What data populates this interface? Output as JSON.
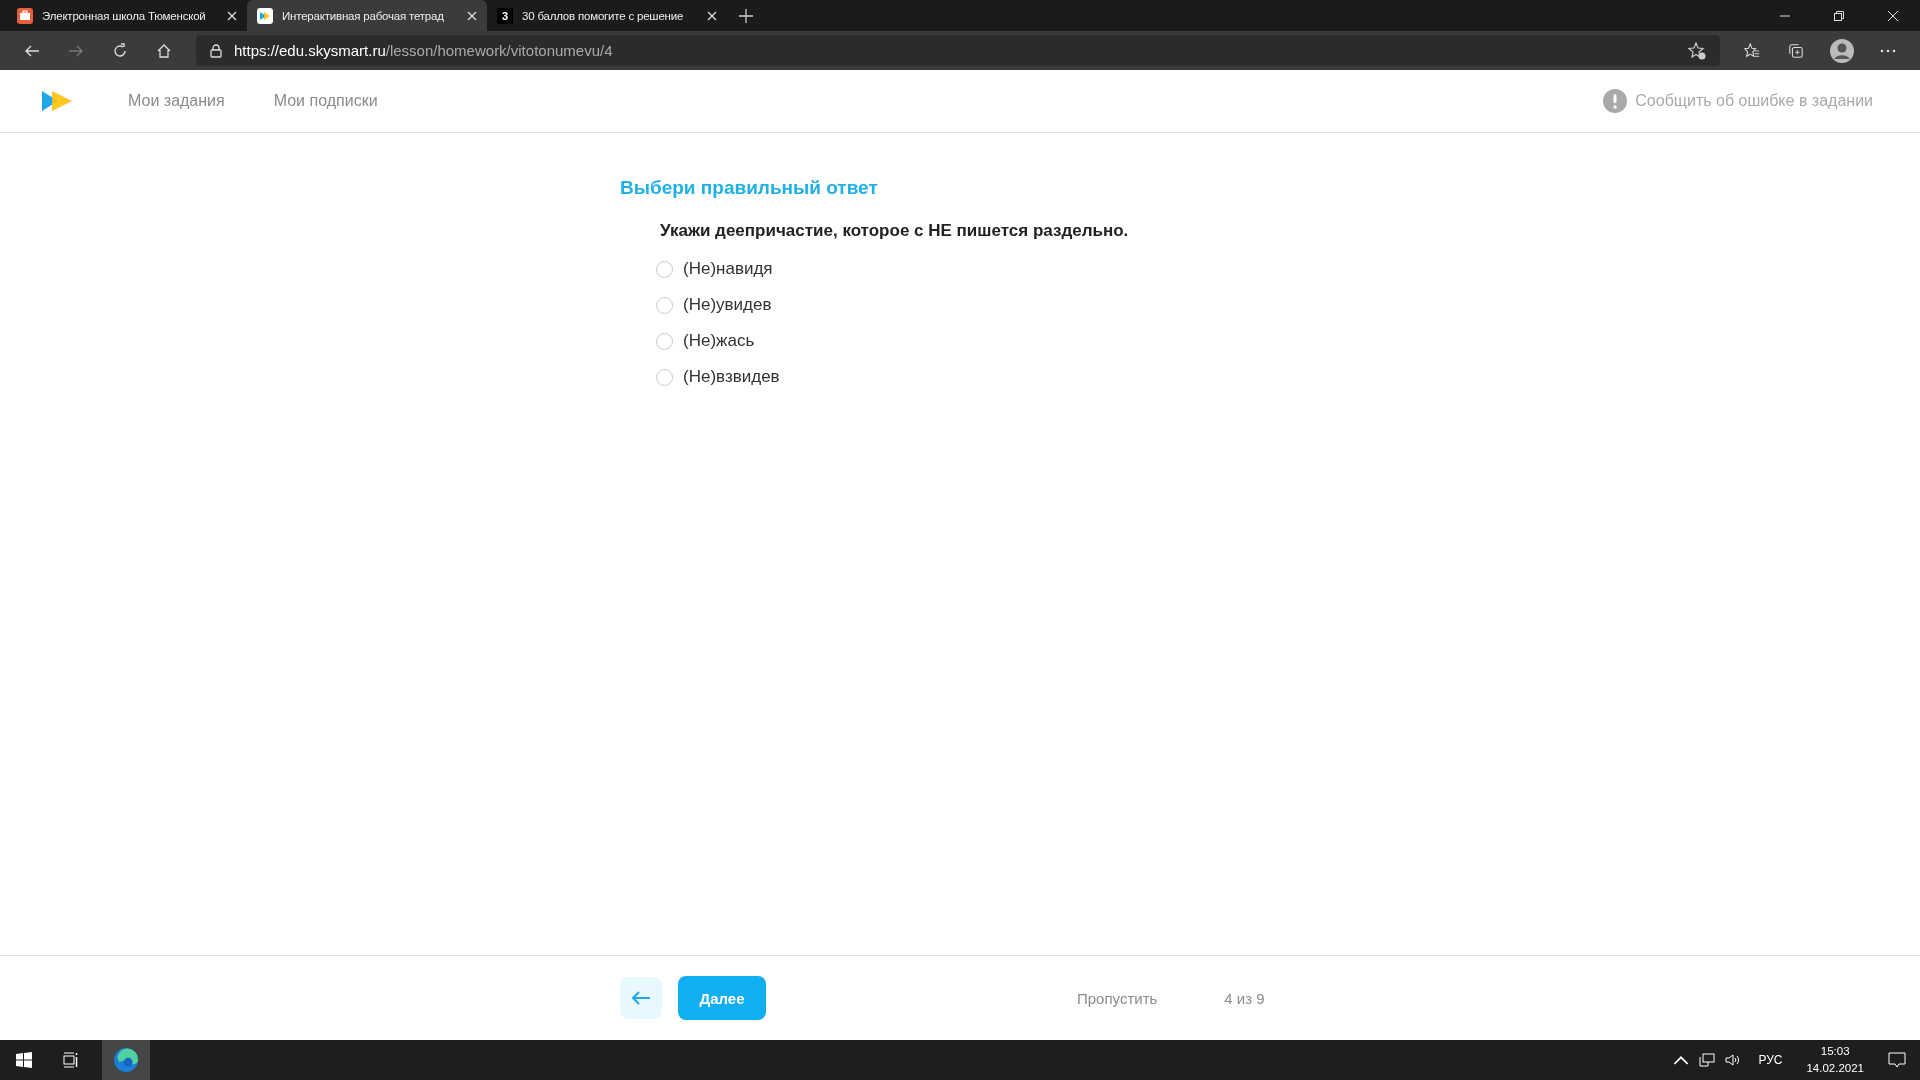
{
  "browser": {
    "tabs": [
      {
        "title": "Электронная школа Тюменской",
        "kind": "school",
        "selected": false
      },
      {
        "title": "Интерактивная рабочая тетрад",
        "kind": "skysmart",
        "selected": true
      },
      {
        "title": "30 баллов помогите с решение",
        "kind": "znanija",
        "selected": false
      }
    ],
    "tab_favicon_letter": "3",
    "address": {
      "host": "https://edu.skysmart.ru",
      "path": "/lesson/homework/vitotonumevu/4"
    }
  },
  "header": {
    "nav": [
      "Мои задания",
      "Мои подписки"
    ],
    "report": "Сообщить об ошибке в задании"
  },
  "task": {
    "heading": "Выбери правильный ответ",
    "question": "Укажи деепричастие, которое с НЕ пишется раздельно.",
    "options": [
      {
        "label": "(Не)навидя",
        "selected": false
      },
      {
        "label": "(Не)увидев",
        "selected": false
      },
      {
        "label": "(Не)жась",
        "selected": false
      },
      {
        "label": "(Не)взвидев",
        "selected": false
      }
    ]
  },
  "footer": {
    "next": "Далее",
    "skip": "Пропустить",
    "progress": "4 из 9"
  },
  "taskbar": {
    "language": "РУС",
    "time": "15:03",
    "date": "14.02.2021"
  }
}
